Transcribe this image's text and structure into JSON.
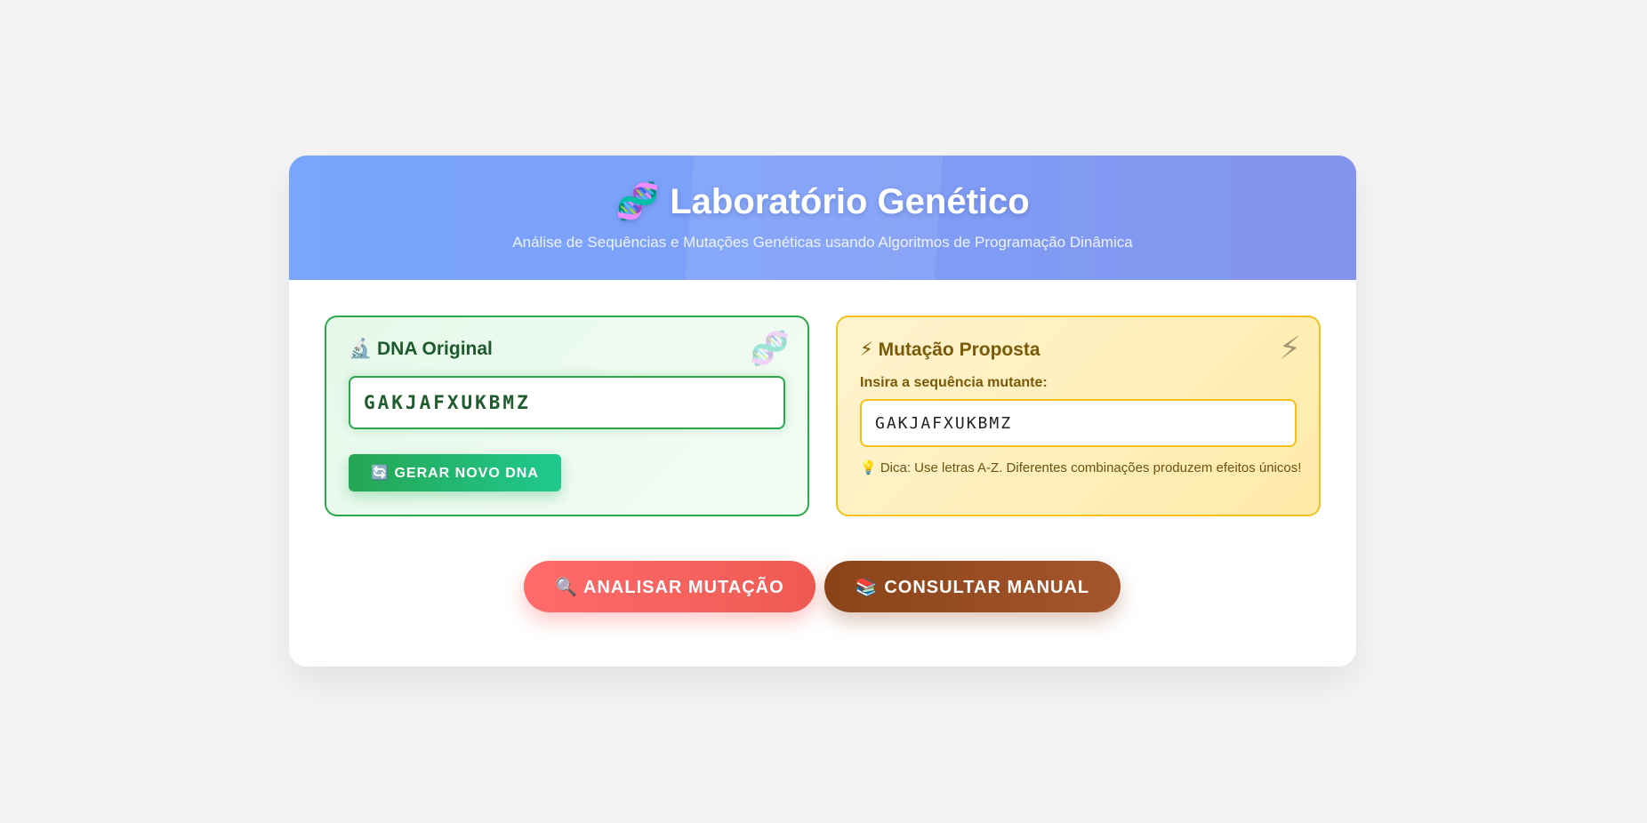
{
  "header": {
    "title": "🧬 Laboratório Genético",
    "subtitle": "Análise de Sequências e Mutações Genéticas usando Algoritmos de Programação Dinâmica"
  },
  "original_panel": {
    "title": "🔬 DNA Original",
    "decor_icon": "🧬",
    "sequence": "GAKJAFXUKBMZ",
    "generate_label": "🔄 GERAR NOVO DNA"
  },
  "mutation_panel": {
    "title": "⚡ Mutação Proposta",
    "decor_icon": "⚡",
    "label": "Insira a sequência mutante:",
    "value": "GAKJAFXUKBMZ",
    "hint": "💡 Dica: Use letras A-Z. Diferentes combinações produzem efeitos únicos!"
  },
  "actions": {
    "analyze_label": "🔍 ANALISAR MUTAÇÃO",
    "manual_label": "📚 CONSULTAR MANUAL"
  },
  "colors": {
    "header_start": "#79a5fc",
    "header_end": "#8494ec",
    "green_accent": "#2aa84a",
    "yellow_accent": "#f2c21a",
    "analyze_button": "#ff6b6b",
    "manual_button": "#8a4318"
  }
}
